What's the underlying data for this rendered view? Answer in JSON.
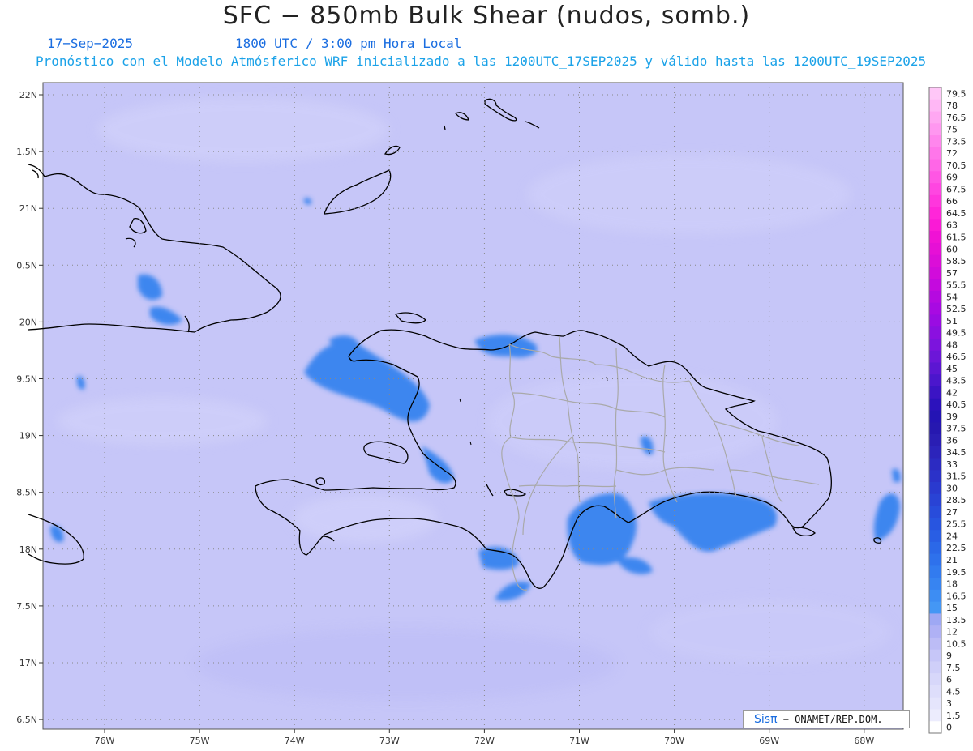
{
  "header": {
    "title": "SFC − 850mb Bulk Shear (nudos, somb.)",
    "date": "17−Sep−2025",
    "time": "1800 UTC / 3:00 pm Hora Local",
    "info": "Pronóstico con el Modelo Atmósferico WRF inicializado a las 1200UTC_17SEP2025 y válido hasta las  1200UTC_19SEP2025"
  },
  "map": {
    "lon_range": [
      -76.6,
      -67.6
    ],
    "lat_range": [
      16.35,
      22.1
    ],
    "lat_ticks": [
      "22N",
      "1.5N",
      "21N",
      "0.5N",
      "20N",
      "9.5N",
      "19N",
      "8.5N",
      "18N",
      "7.5N",
      "17N",
      "6.5N"
    ],
    "lon_ticks": [
      "76W",
      "75W",
      "74W",
      "73W",
      "72W",
      "71W",
      "70W",
      "69W",
      "68W"
    ],
    "background_color": "#c6c6f8",
    "highlight_color": "#3d86ef"
  },
  "colorbar": {
    "labels": [
      "79.5",
      "78",
      "76.5",
      "75",
      "73.5",
      "72",
      "70.5",
      "69",
      "67.5",
      "66",
      "64.5",
      "63",
      "61.5",
      "60",
      "58.5",
      "57",
      "55.5",
      "54",
      "52.5",
      "51",
      "49.5",
      "48",
      "46.5",
      "45",
      "43.5",
      "42",
      "40.5",
      "39",
      "37.5",
      "36",
      "34.5",
      "33",
      "31.5",
      "30",
      "28.5",
      "27",
      "25.5",
      "24",
      "22.5",
      "21",
      "19.5",
      "18",
      "16.5",
      "15",
      "13.5",
      "12",
      "10.5",
      "9",
      "7.5",
      "6",
      "4.5",
      "3",
      "1.5",
      "0"
    ],
    "colors": [
      "#ffc7f7",
      "#ffb7f5",
      "#ffa7f2",
      "#ff97f0",
      "#ff86ed",
      "#ff76ea",
      "#ff66e7",
      "#ff56e4",
      "#ff46e1",
      "#ff36dd",
      "#ff26d9",
      "#fa1ad6",
      "#f012d5",
      "#e610d6",
      "#db0ed8",
      "#d10cdb",
      "#c40ade",
      "#b50ae0",
      "#a80ae2",
      "#9a0ce2",
      "#8b10e0",
      "#7c14dd",
      "#6c16d8",
      "#5c16d2",
      "#4b16cc",
      "#3b14c4",
      "#2c12bc",
      "#2414b4",
      "#2618b0",
      "#2a1eb4",
      "#2c24bb",
      "#2c2bc2",
      "#2b32c9",
      "#2a3acf",
      "#2943d5",
      "#284cdb",
      "#2855e0",
      "#295ee4",
      "#2b68e8",
      "#2e71ec",
      "#327bef",
      "#3784f1",
      "#3d8df3",
      "#4497f5",
      "#9ea8f4",
      "#afb1f5",
      "#bcbcf6",
      "#c6c6f8",
      "#cfcff9",
      "#d7d7fa",
      "#dedefb",
      "#e5e5fc",
      "#ececfd",
      "#ffffff"
    ]
  },
  "credit": {
    "brand": "Sisπ",
    "text": " − ONAMET/REP.DOM."
  }
}
